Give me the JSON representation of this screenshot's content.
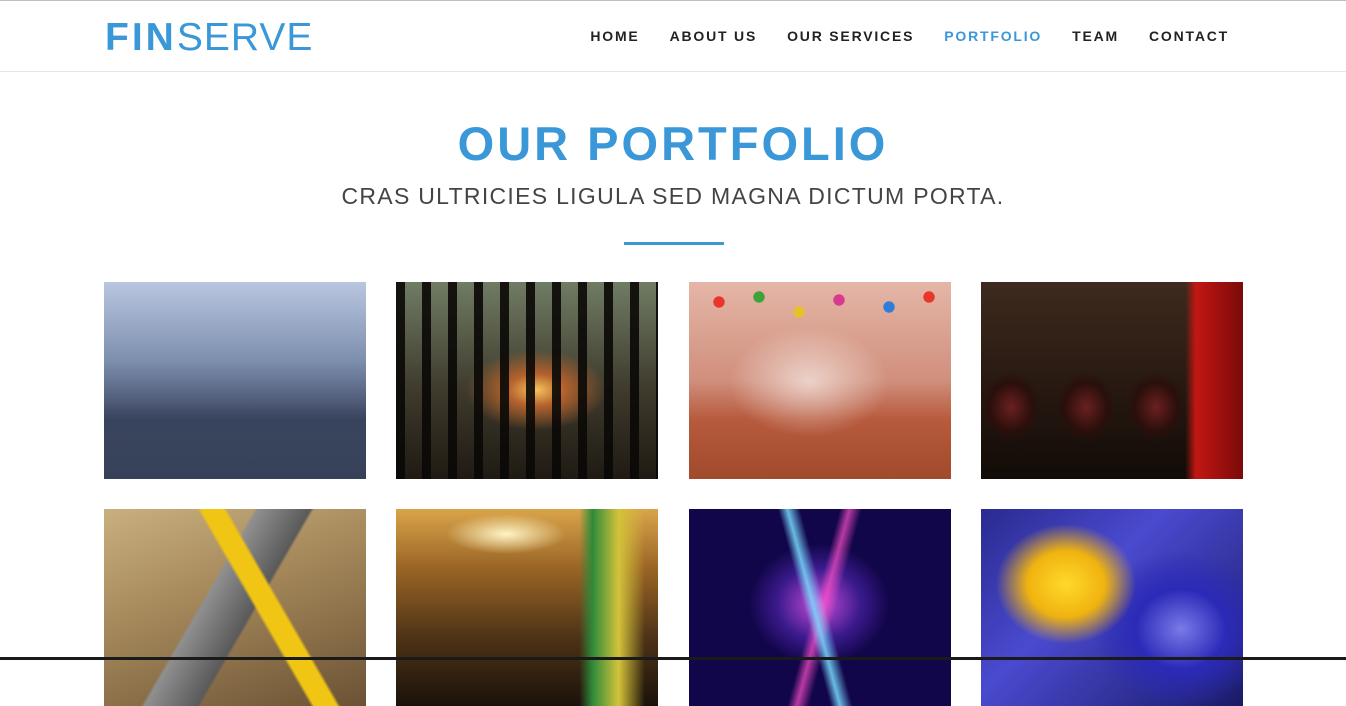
{
  "brand": {
    "part1": "FIN",
    "part2": "SERVE"
  },
  "nav": {
    "items": [
      {
        "label": "HOME",
        "active": false
      },
      {
        "label": "ABOUT US",
        "active": false
      },
      {
        "label": "OUR SERVICES",
        "active": false
      },
      {
        "label": "PORTFOLIO",
        "active": true
      },
      {
        "label": "TEAM",
        "active": false
      },
      {
        "label": "CONTACT",
        "active": false
      }
    ]
  },
  "portfolio": {
    "title": "OUR PORTFOLIO",
    "subtitle": "CRAS ULTRICIES LIGULA SED MAGNA DICTUM PORTA.",
    "items": [
      {
        "image": "street-photo-exhibition"
      },
      {
        "image": "forest-sunset"
      },
      {
        "image": "balloon-party-hall"
      },
      {
        "image": "wine-barrels-cellar"
      },
      {
        "image": "measuring-tape-tools"
      },
      {
        "image": "shopping-mall-escalator"
      },
      {
        "image": "abstract-light-burst"
      },
      {
        "image": "yellow-daffodil"
      }
    ]
  },
  "colors": {
    "accent": "#3a97d8",
    "nav_text": "#222222",
    "subtitle": "#444444"
  }
}
